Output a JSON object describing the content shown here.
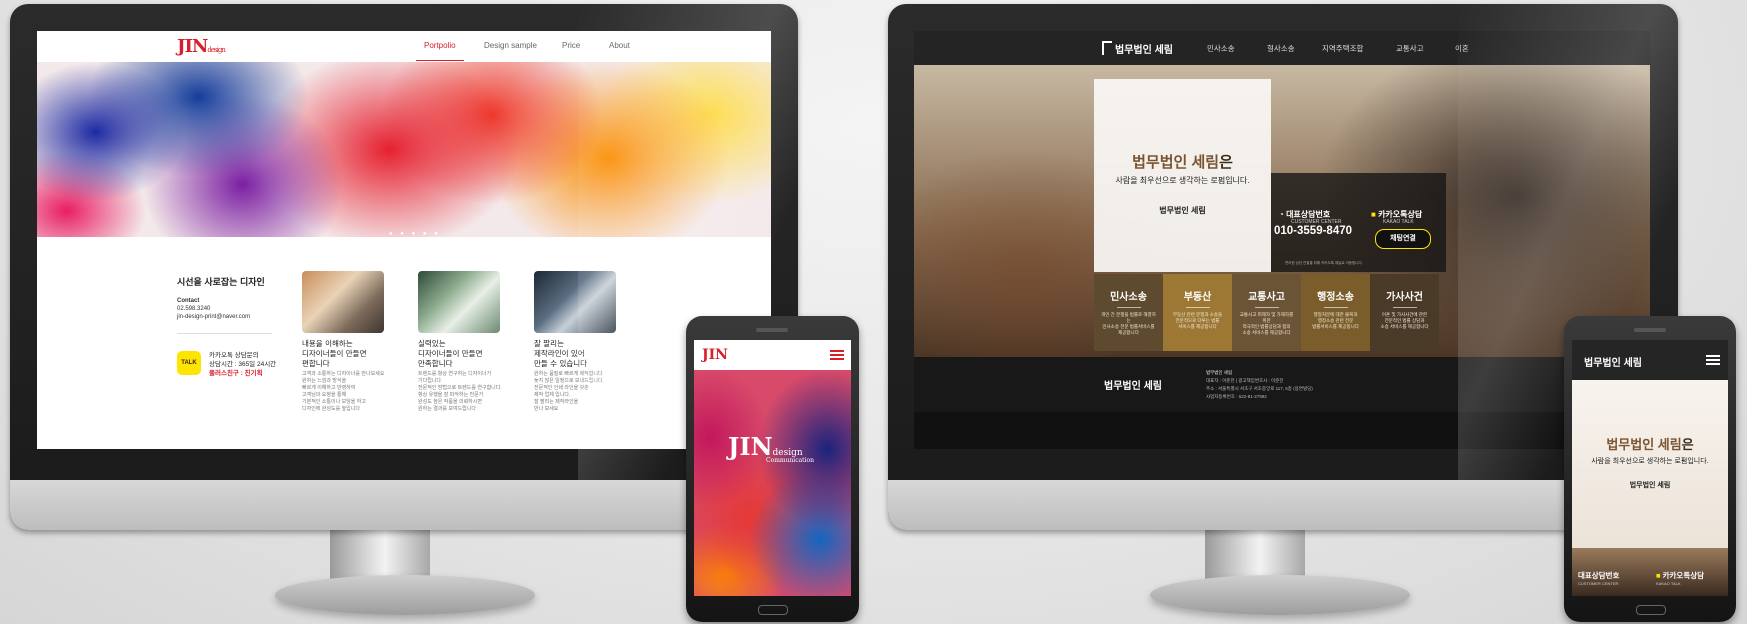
{
  "jin": {
    "logo": "JIN",
    "logo_sub": "design",
    "menu": [
      "Portpolio",
      "Design sample",
      "Price",
      "About"
    ],
    "dots": "● ● ● ● ●",
    "section_title": "시선을 사로잡는 디자인",
    "contact_label": "Contact",
    "contact_phone": "02.598.3240",
    "contact_email": "jin-design-print@naver.com",
    "talk_badge": "TALK",
    "talk_line1": "카카오톡 상담문의",
    "talk_line2": "상담시간 : 365일 24시간",
    "talk_line3": "플러스친구 : 진기획",
    "cards": [
      {
        "head1": "내용을 이해하는",
        "head2": "디자이너들이 만들면",
        "head3": "편합니다",
        "b1": "고객과 소통하는 디자이너를 만나보세요",
        "b2": "원하는 느낌과 방식을",
        "b3": "빠르게 이해하고 반영하여",
        "b4": "고객님의 요청을 통해",
        "b5": "기본적인 소통이나 모임을 하고",
        "b6": "디자인에 완성도를 높입니다"
      },
      {
        "head1": "실력있는",
        "head2": "디자이너들이 만들면",
        "head3": "만족합니다",
        "b1": "트렌드를 항상 연구하는 디자이너가",
        "b2": "기다립니다.",
        "b3": "전문적인 방법으로 트렌드를 연구합니다.",
        "b4": "항상 유행을 잘 파악하는 전문가",
        "b5": "완성도 높은 작품을 의뢰하시면",
        "b6": "원하는 결과를 보여드립니다"
      },
      {
        "head1": "잘 팔리는",
        "head2": "제작라인이 있어",
        "head3": "만들 수 있습니다",
        "b1": "원하는 품질로 빠르게 제작합니다",
        "b2": "늦지 않은 일정으로 보내드립니다.",
        "b3": "전문적인 인쇄 라인을 갖춘",
        "b4": "제작 업체 입니다.",
        "b5": "잘 팔리는 제작라인을",
        "b6": "만나 보세요"
      }
    ]
  },
  "law": {
    "logo": "법무법인 세림",
    "menu": [
      "민사소송",
      "형사소송",
      "지역주택조합",
      "교통사고",
      "이혼"
    ],
    "hero_accent": "법무법인 세림",
    "hero_suffix": "은",
    "hero_sub": "사람을 최우선으로 생각하는 로펌입니다.",
    "box_logo": "법무법인 세림",
    "cc_label": "대표상담번호",
    "cc_sub": "CUSTOMER CENTER",
    "kakao_label": "카카오톡상담",
    "kakao_sub": "KAKAO TALK",
    "phone": "010-3559-8470",
    "chat_button": "채팅연결",
    "fine_print": "편리한 상담 연결을 위해 카카오톡 채널로 이동합니다.",
    "categories": [
      {
        "title": "민사소송",
        "d1": "개인 간 분쟁을 법률로 해결하는",
        "d2": "민사소송 전문 법률서비스를",
        "d3": "제공합니다",
        "color": "#5e4a2e"
      },
      {
        "title": "부동산",
        "d1": "부동산 관련 분쟁과 소송을",
        "d2": "전문적으로 다루는 법률",
        "d3": "서비스를 제공합니다",
        "color": "#9c7834"
      },
      {
        "title": "교통사고",
        "d1": "교통사고 피해자 및 가해자를 위한",
        "d2": "적극적인 법률상담과 합의",
        "d3": "소송 서비스를 제공합니다",
        "color": "#6b5336"
      },
      {
        "title": "행정소송",
        "d1": "행정처분에 대한 불복과",
        "d2": "행정소송 관련 전문",
        "d3": "법률서비스를 제공합니다",
        "color": "#7a5d2b"
      },
      {
        "title": "가사사건",
        "d1": "이혼 및 가사사건에 관한",
        "d2": "전문적인 법률 상담과",
        "d3": "소송 서비스를 제공합니다",
        "color": "#4a3b28"
      }
    ],
    "foot_logo": "법무법인 세림",
    "foot_title": "법무법인 세림",
    "foot_line1": "대표자 : 이준헌 | 광고책임변호사 : 이준헌",
    "foot_line2": "주소 : 서울특별시 서초구 서초중앙로 117, 5층 (용연빌딩)",
    "foot_line3": "사업자등록번호 : 622-81-27992"
  },
  "jin_mobile": {
    "logo": "JIN",
    "brand": "JIN",
    "brand_sub": "design",
    "brand_sub2": "Communication"
  },
  "law_mobile": {
    "logo": "법무법인 세림",
    "hero_accent": "법무법인 세림",
    "hero_suffix": "은",
    "hero_sub": "사람을 최우선으로 생각하는 로펌입니다.",
    "box_logo": "법무법인 세림",
    "cc_label": "대표상담번호",
    "cc_sub": "CUSTOMER CENTER",
    "kakao_label": "카카오톡상담",
    "kakao_sub": "KAKAO TALK"
  }
}
